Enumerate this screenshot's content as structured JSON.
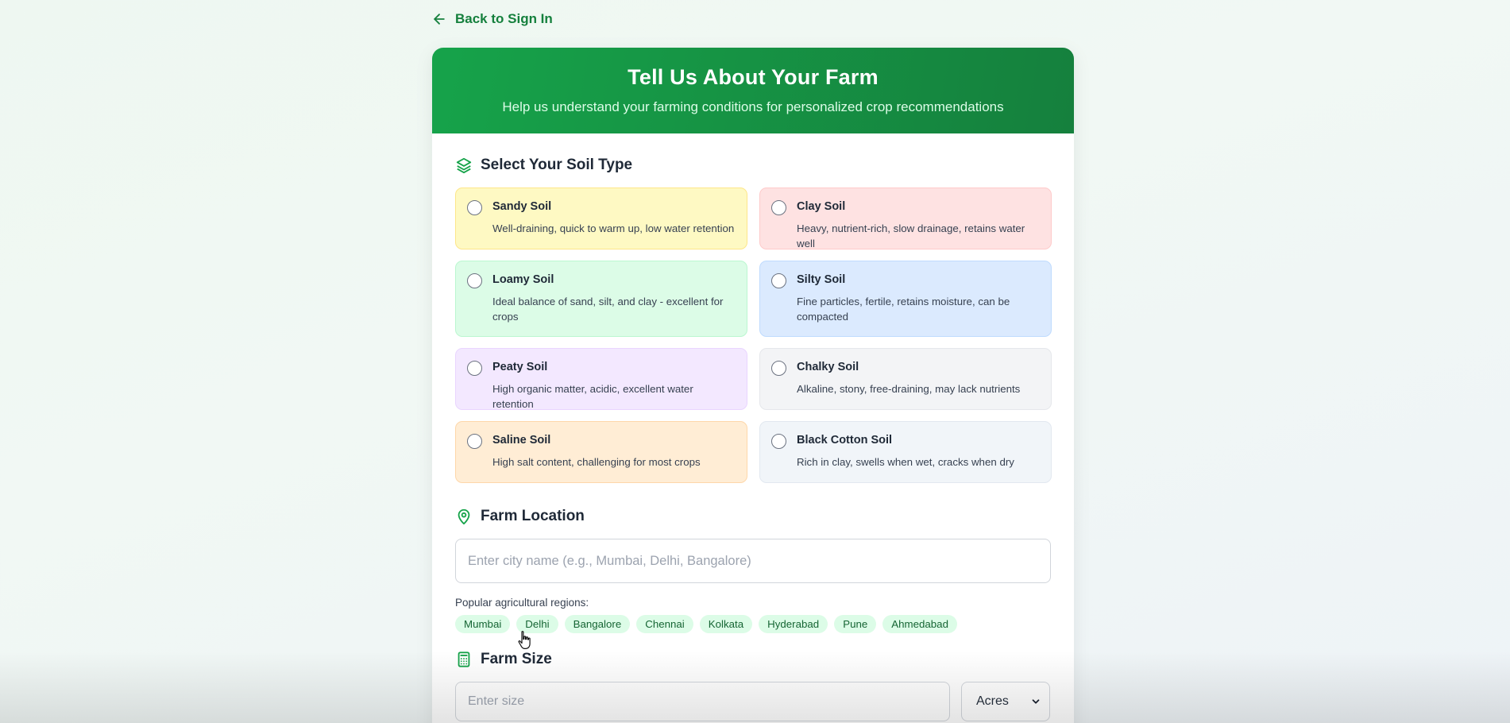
{
  "back_link": {
    "label": "Back to Sign In",
    "icon": "arrow-left-icon"
  },
  "header": {
    "title": "Tell Us About Your Farm",
    "subtitle": "Help us understand your farming conditions for personalized crop recommendations"
  },
  "soil_section": {
    "title": "Select Your Soil Type",
    "icon": "layers-icon",
    "options": [
      {
        "name": "Sandy Soil",
        "desc": "Well-draining, quick to warm up, low water retention",
        "bg": "#fef9c3",
        "border": "#fde68a"
      },
      {
        "name": "Clay Soil",
        "desc": "Heavy, nutrient-rich, slow drainage, retains water well",
        "bg": "#fee2e2",
        "border": "#fecaca"
      },
      {
        "name": "Loamy Soil",
        "desc": "Ideal balance of sand, silt, and clay - excellent for crops",
        "bg": "#dcfce7",
        "border": "#bbf7d0"
      },
      {
        "name": "Silty Soil",
        "desc": "Fine particles, fertile, retains moisture, can be compacted",
        "bg": "#dbeafe",
        "border": "#bfdbfe"
      },
      {
        "name": "Peaty Soil",
        "desc": "High organic matter, acidic, excellent water retention",
        "bg": "#f3e8ff",
        "border": "#e9d5ff"
      },
      {
        "name": "Chalky Soil",
        "desc": "Alkaline, stony, free-draining, may lack nutrients",
        "bg": "#f3f4f6",
        "border": "#e5e7eb"
      },
      {
        "name": "Saline Soil",
        "desc": "High salt content, challenging for most crops",
        "bg": "#ffedd5",
        "border": "#fed7aa"
      },
      {
        "name": "Black Cotton Soil",
        "desc": "Rich in clay, swells when wet, cracks when dry",
        "bg": "#f1f5f9",
        "border": "#e2e8f0"
      }
    ]
  },
  "location_section": {
    "title": "Farm Location",
    "icon": "map-pin-icon",
    "placeholder": "Enter city name (e.g., Mumbai, Delhi, Bangalore)",
    "regions_label": "Popular agricultural regions:",
    "regions": [
      "Mumbai",
      "Delhi",
      "Bangalore",
      "Chennai",
      "Kolkata",
      "Hyderabad",
      "Pune",
      "Ahmedabad"
    ]
  },
  "size_section": {
    "title": "Farm Size",
    "icon": "calculator-icon",
    "placeholder": "Enter size",
    "unit": "Acres"
  },
  "colors": {
    "accent": "#16a34a",
    "accent_dark": "#15803d"
  }
}
